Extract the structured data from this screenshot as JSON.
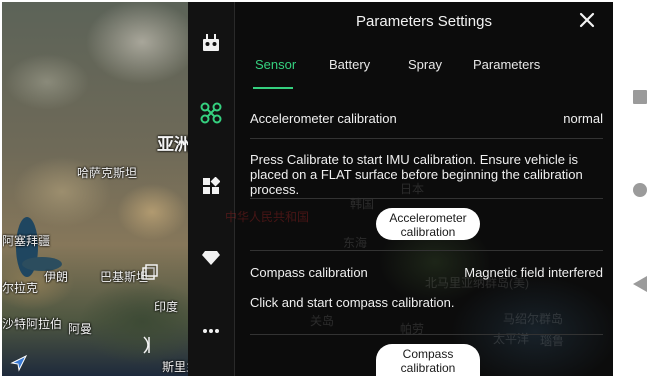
{
  "map": {
    "labels": [
      "哈萨克斯坦",
      "亚洲",
      "阿塞拜疆",
      "伊朗",
      "巴基斯坦",
      "印度",
      "尔拉克",
      "沙特阿拉伯",
      "阿曼",
      "斯里兰卡"
    ]
  },
  "background_labels": [
    "日本",
    "韩国",
    "中华人民共和国",
    "东海",
    "北马里亚纳群岛(美)",
    "马绍尔群岛",
    "关岛",
    "太平洋",
    "帕劳",
    "瑙鲁"
  ],
  "toolbar": {
    "icons": [
      "remote-controller-icon",
      "drone-icon",
      "apps-icon",
      "diamond-icon",
      "more-icon"
    ]
  },
  "panel": {
    "title": "Parameters Settings",
    "tabs": [
      "Sensor",
      "Battery",
      "Spray",
      "Parameters"
    ],
    "active_tab": "Sensor",
    "accel": {
      "label": "Accelerometer calibration",
      "status": "normal",
      "description": "Press Calibrate to start IMU calibration. Ensure vehicle is placed on a FLAT surface before beginning the calibration process.",
      "button_line1": "Accelerometer",
      "button_line2": "calibration"
    },
    "compass": {
      "label": "Compass calibration",
      "status": "Magnetic field interfered",
      "description": "Click and start compass calibration.",
      "button_line1": "Compass",
      "button_line2": "calibration"
    }
  },
  "colors": {
    "accent": "#35d07f",
    "panel_bg": "#0c0c0c",
    "toolbar_bg": "#121212"
  }
}
